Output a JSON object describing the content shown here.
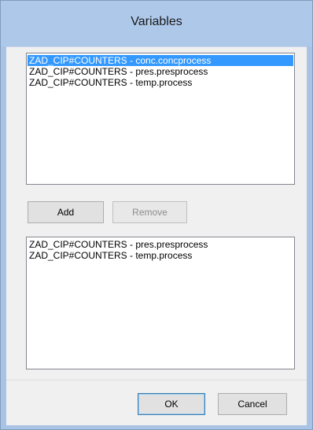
{
  "window": {
    "title": "Variables"
  },
  "available_list": {
    "items": [
      {
        "label": "ZAD_CIP#COUNTERS - conc.concprocess",
        "selected": true
      },
      {
        "label": "ZAD_CIP#COUNTERS - pres.presprocess",
        "selected": false
      },
      {
        "label": "ZAD_CIP#COUNTERS - temp.process",
        "selected": false
      }
    ]
  },
  "buttons": {
    "add_label": "Add",
    "remove_label": "Remove",
    "ok_label": "OK",
    "cancel_label": "Cancel"
  },
  "selected_list": {
    "items": [
      {
        "label": "ZAD_CIP#COUNTERS - pres.presprocess"
      },
      {
        "label": "ZAD_CIP#COUNTERS - temp.process"
      }
    ]
  },
  "colors": {
    "title_bar": "#aec8ea",
    "selection": "#3399ff"
  }
}
